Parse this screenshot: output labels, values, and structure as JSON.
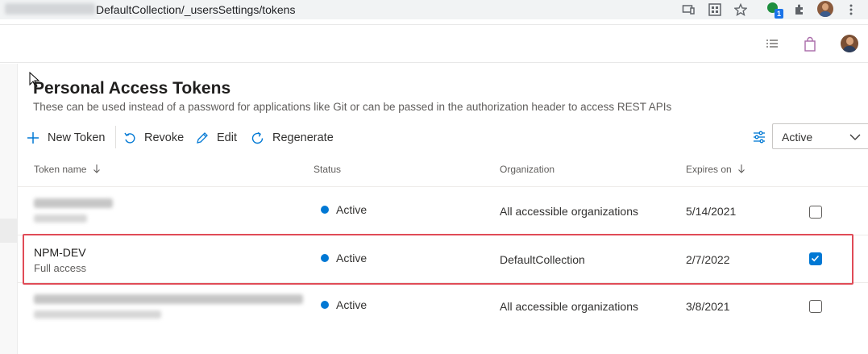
{
  "browser": {
    "url_path": "DefaultCollection/_usersSettings/tokens",
    "icons": [
      "cast-icon",
      "qr-icon",
      "star-icon",
      "extension-badge-icon",
      "puzzle-icon",
      "profile-icon",
      "kebab-menu-icon"
    ],
    "extension_badge_count": "1"
  },
  "app_bar": {
    "icons": [
      "task-list-icon",
      "marketplace-bag-icon",
      "user-avatar"
    ]
  },
  "page": {
    "title": "Personal Access Tokens",
    "subtitle": "These can be used instead of a password for applications like Git or can be passed in the authorization header to access REST APIs"
  },
  "toolbar": {
    "new_token": "New Token",
    "revoke": "Revoke",
    "edit": "Edit",
    "regenerate": "Regenerate",
    "status_filter_value": "Active"
  },
  "table": {
    "headers": {
      "name": "Token name",
      "status": "Status",
      "organization": "Organization",
      "expires": "Expires on"
    },
    "rows": [
      {
        "name": "",
        "sub": "",
        "status": "Active",
        "organization": "All accessible organizations",
        "expires": "5/14/2021",
        "checked": false
      },
      {
        "name": "NPM-DEV",
        "sub": "Full access",
        "status": "Active",
        "organization": "DefaultCollection",
        "expires": "2/7/2022",
        "checked": true
      },
      {
        "name": "",
        "sub": "",
        "status": "Active",
        "organization": "All accessible organizations",
        "expires": "3/8/2021",
        "checked": false
      }
    ]
  },
  "colors": {
    "accent": "#0078d4",
    "highlight": "#e04b57"
  }
}
